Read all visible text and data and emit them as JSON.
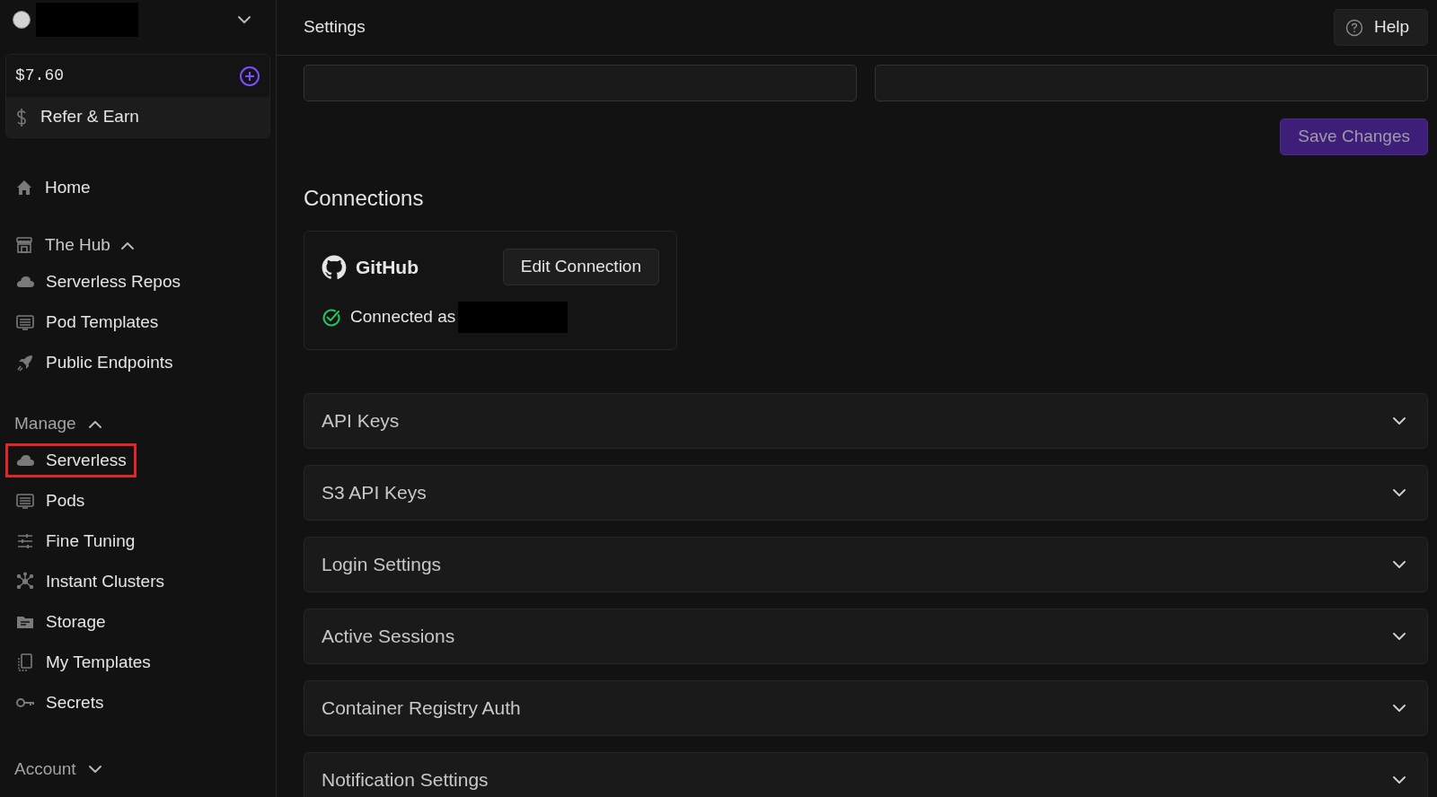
{
  "account": {
    "balance": "$7.60",
    "refer": "Refer & Earn"
  },
  "nav": [
    {
      "kind": "link",
      "label": "Home"
    },
    {
      "kind": "group",
      "label": "The Hub",
      "expanded": true,
      "items": [
        {
          "label": "Serverless Repos",
          "highlighted": false
        },
        {
          "label": "Pod Templates",
          "highlighted": false
        },
        {
          "label": "Public Endpoints",
          "highlighted": false
        }
      ]
    },
    {
      "kind": "group",
      "label": "Manage",
      "expanded": true,
      "items": [
        {
          "label": "Serverless",
          "highlighted": true
        },
        {
          "label": "Pods",
          "highlighted": false
        },
        {
          "label": "Fine Tuning",
          "highlighted": false
        },
        {
          "label": "Instant Clusters",
          "highlighted": false
        },
        {
          "label": "Storage",
          "highlighted": false
        },
        {
          "label": "My Templates",
          "highlighted": false
        },
        {
          "label": "Secrets",
          "highlighted": false
        }
      ]
    },
    {
      "kind": "group",
      "label": "Account",
      "expanded": false
    }
  ],
  "header": {
    "title": "Settings",
    "help": "Help"
  },
  "save_button": "Save Changes",
  "connections": {
    "heading": "Connections",
    "card": {
      "name": "GitHub",
      "button": "Edit Connection",
      "status": "Connected as",
      "connected": true
    }
  },
  "panels": [
    {
      "label": "API Keys",
      "expanded": false
    },
    {
      "label": "S3 API Keys",
      "expanded": false
    },
    {
      "label": "Login Settings",
      "expanded": false
    },
    {
      "label": "Active Sessions",
      "expanded": false
    },
    {
      "label": "Container Registry Auth",
      "expanded": false
    },
    {
      "label": "Notification Settings",
      "expanded": false
    }
  ]
}
